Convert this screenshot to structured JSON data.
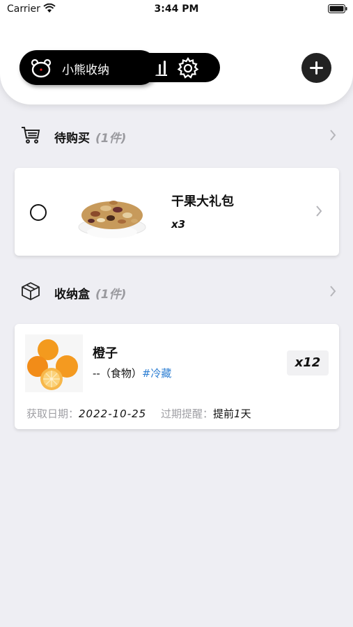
{
  "status_bar": {
    "carrier": "Carrier",
    "time": "3:44 PM"
  },
  "header": {
    "app_title": "小熊收纳"
  },
  "shopping": {
    "title": "待购买",
    "count": "(1件)",
    "items": [
      {
        "name": "干果大礼包",
        "qty": "x3"
      }
    ]
  },
  "storage": {
    "title": "收纳盒",
    "count": "(1件)",
    "items": [
      {
        "name": "橙子",
        "category": "--（食物）",
        "tag": "#冷藏",
        "qty": "x12",
        "date_label": "获取日期：",
        "date": "2022-10-25",
        "reminder_label": "过期提醒：",
        "reminder_pre": "提前",
        "reminder_num": "1",
        "reminder_post": "天"
      }
    ]
  },
  "colors": {
    "header_bg": "#ffffff",
    "page_bg": "#eeeef3",
    "tag_blue": "#2e7fd3",
    "pill_black": "#000000"
  }
}
